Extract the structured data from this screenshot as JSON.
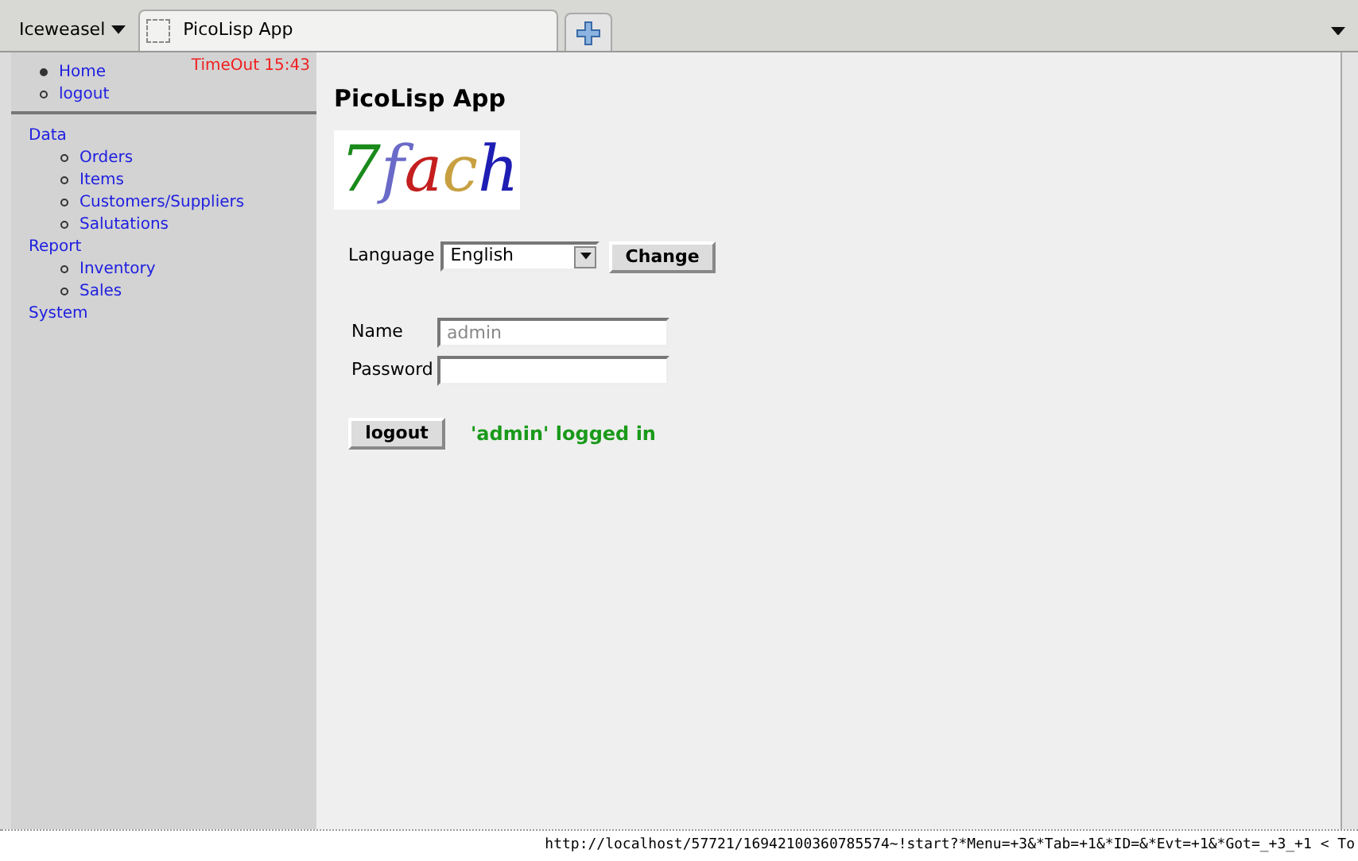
{
  "browser": {
    "menu_label": "Iceweasel",
    "tabs": [
      {
        "title": "PicoLisp App",
        "selected": true
      }
    ]
  },
  "sidebar": {
    "timeout": "TimeOut 15:43",
    "top_links": [
      {
        "label": "Home",
        "selected": true
      },
      {
        "label": "logout",
        "selected": false
      }
    ],
    "menu": [
      {
        "label": "Data",
        "children": [
          {
            "label": "Orders"
          },
          {
            "label": "Items"
          },
          {
            "label": "Customers/Suppliers"
          },
          {
            "label": "Salutations"
          }
        ]
      },
      {
        "label": "Report",
        "children": [
          {
            "label": "Inventory"
          },
          {
            "label": "Sales"
          }
        ]
      },
      {
        "label": "System"
      }
    ]
  },
  "page": {
    "title": "PicoLisp App",
    "logo": [
      "7",
      "f",
      "a",
      "c",
      "h"
    ],
    "language": {
      "label": "Language",
      "value": "English",
      "button": "Change"
    },
    "name": {
      "label": "Name",
      "value": "admin",
      "disabled": true
    },
    "password": {
      "label": "Password"
    },
    "logout_button": "logout",
    "status": "'admin' logged in"
  },
  "status_bar": "http://localhost/57721/16942100360785574~!start?*Menu=+3&*Tab=+1&*ID=&*Evt=+1&*Got=_+3_+1 < To"
}
